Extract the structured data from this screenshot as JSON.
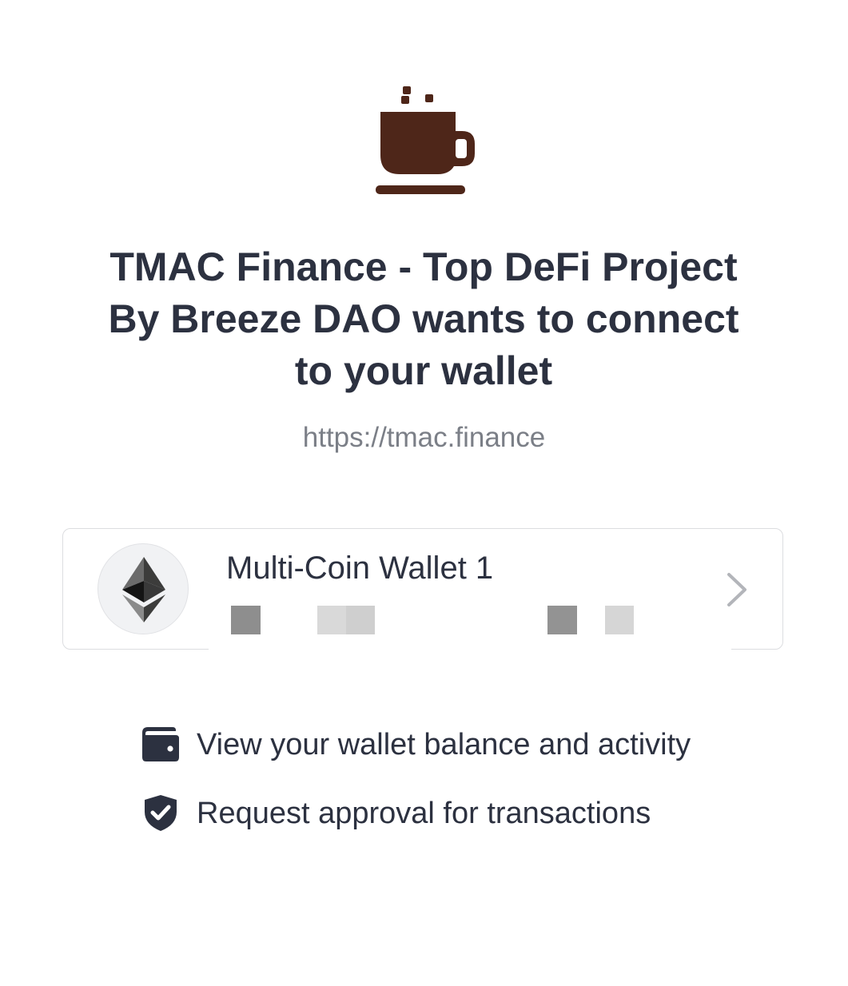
{
  "dapp": {
    "logo_icon": "coffee-cup-icon",
    "logo_color": "#4e2619",
    "title": "TMAC Finance - Top DeFi Project By Breeze DAO wants to connect to your wallet",
    "url": "https://tmac.finance"
  },
  "wallet": {
    "icon": "ethereum-icon",
    "name": "Multi-Coin Wallet 1",
    "address_redacted": true,
    "chevron_icon": "chevron-right-icon"
  },
  "permissions": [
    {
      "icon": "wallet-icon",
      "label": "View your wallet balance and activity"
    },
    {
      "icon": "shield-check-icon",
      "label": "Request approval for transactions"
    }
  ],
  "colors": {
    "text": "#2c3140",
    "muted": "#7b7f87",
    "border": "#dcdde0"
  }
}
